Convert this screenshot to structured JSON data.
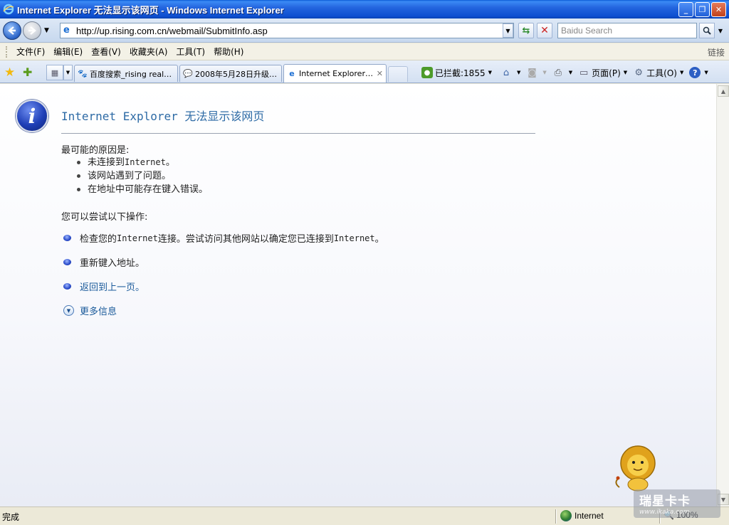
{
  "window": {
    "title": "Internet Explorer 无法显示该网页 - Windows Internet Explorer",
    "buttons": [
      "_",
      "❐",
      "✕"
    ]
  },
  "address_bar": {
    "url": "http://up.rising.com.cn/webmail/SubmitInfo.asp",
    "search_placeholder": "Baidu Search"
  },
  "menu": {
    "items": [
      "文件(F)",
      "编辑(E)",
      "查看(V)",
      "收藏夹(A)",
      "工具(T)",
      "帮助(H)"
    ],
    "links_label": "链接"
  },
  "tabs": [
    {
      "label": "百度搜索_rising realti…",
      "icon": "paw-icon"
    },
    {
      "label": "2008年5月28日升级…",
      "icon": "chat-icon"
    },
    {
      "label": "Internet Explorer …",
      "icon": "ie-page-icon",
      "active": true
    }
  ],
  "command_bar": {
    "blocked_label": "已拦截:1855",
    "page_label": "页面(P)",
    "tools_label": "工具(O)"
  },
  "error_page": {
    "title": "Internet Explorer 无法显示该网页",
    "reasons_heading": "最可能的原因是:",
    "reasons": [
      {
        "pre": "未连接到 ",
        "mono": "Internet",
        "post": "。"
      },
      {
        "pre": "该网站遇到了问题。",
        "mono": "",
        "post": ""
      },
      {
        "pre": "在地址中可能存在键入错误。",
        "mono": "",
        "post": ""
      }
    ],
    "try_heading": "您可以尝试以下操作:",
    "action_check": {
      "p1": "检查您的 ",
      "m1": "Internet",
      "p2": " 连接。尝试访问其他网站以确定您已连接到 ",
      "m2": "Internet",
      "p3": "。"
    },
    "action_retype": "重新键入地址。",
    "action_back": "返回到上一页。",
    "more_info": "更多信息"
  },
  "status_bar": {
    "status": "完成",
    "zone": "Internet",
    "zoom": "100%"
  },
  "watermark": {
    "text": "瑞星卡卡",
    "sub": "www.ikaka.com"
  },
  "colors": {
    "title_blue": "#2d6aa5",
    "link_blue": "#1a5a9a",
    "titlebar": "#0d4fd0"
  }
}
